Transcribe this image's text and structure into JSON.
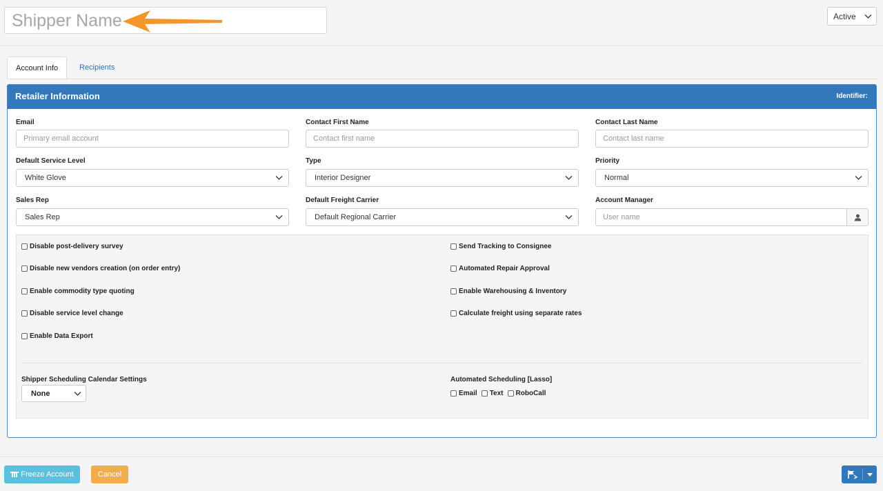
{
  "header": {
    "shipper_placeholder": "Shipper Name",
    "status_value": "Active"
  },
  "tabs": [
    {
      "label": "Account Info",
      "active": true
    },
    {
      "label": "Recipients",
      "active": false
    }
  ],
  "panel": {
    "title": "Retailer Information",
    "identifier_label": "Identifier:"
  },
  "fields": {
    "email": {
      "label": "Email",
      "placeholder": "Primary email account"
    },
    "contact_first": {
      "label": "Contact First Name",
      "placeholder": "Contact first name"
    },
    "contact_last": {
      "label": "Contact Last Name",
      "placeholder": "Contact last name"
    },
    "service_level": {
      "label": "Default Service Level",
      "value": "White Glove"
    },
    "type": {
      "label": "Type",
      "value": "Interior Designer"
    },
    "priority": {
      "label": "Priority",
      "value": "Normal"
    },
    "sales_rep": {
      "label": "Sales Rep",
      "value": "Sales Rep"
    },
    "freight_carrier": {
      "label": "Default Freight Carrier",
      "value": "Default Regional Carrier"
    },
    "account_manager": {
      "label": "Account Manager",
      "placeholder": "User name"
    }
  },
  "settings": {
    "left": [
      "Disable post-delivery survey",
      "Disable new vendors creation (on order entry)",
      "Enable commodity type quoting",
      "Disable service level change",
      "Enable Data Export"
    ],
    "right": [
      "Send Tracking to Consignee",
      "Automated Repair Approval",
      "Enable Warehousing & Inventory",
      "Calculate freight using separate rates"
    ],
    "calendar_label": "Shipper Scheduling Calendar Settings",
    "calendar_value": "None",
    "auto_label": "Automated Scheduling [Lasso]",
    "auto_options": [
      "Email",
      "Text",
      "RoboCall"
    ]
  },
  "footer": {
    "freeze_label": "Freeze Account",
    "cancel_label": "Cancel"
  },
  "colors": {
    "primary": "#3478bc",
    "info": "#5bc0de",
    "warning": "#f0ad4e",
    "annotation_arrow": "#f5962b"
  },
  "icons": [
    "chevron-down-icon",
    "user-icon",
    "freeze-icon",
    "flag-icon",
    "caret-down-icon"
  ]
}
